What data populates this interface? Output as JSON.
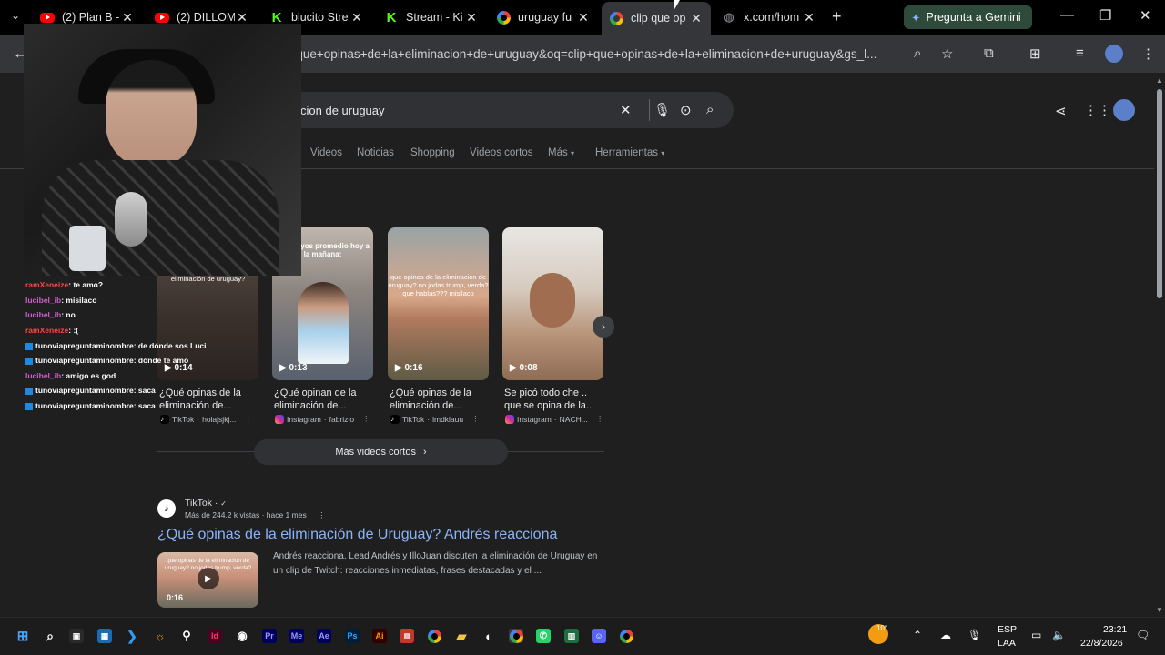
{
  "tabs": [
    {
      "title": "(2) Plan B -",
      "favicon": "youtube-icon"
    },
    {
      "title": "(2) DILLOM",
      "favicon": "youtube-icon"
    },
    {
      "title": "blucito Stre",
      "favicon": "kick-icon"
    },
    {
      "title": "Stream - Ki",
      "favicon": "kick-icon"
    },
    {
      "title": "uruguay fu",
      "favicon": "google-icon"
    },
    {
      "title": "clip que op",
      "favicon": "google-icon",
      "active": true
    },
    {
      "title": "x.com/hom",
      "favicon": "globe-icon"
    }
  ],
  "gemini_label": "Pregunta a Gemini",
  "omnibox_url": "p+que+opinas+de+la+eliminacion+de+uruguay&oq=clip+que+opinas+de+la+eliminacion+de+uruguay&gs_l...",
  "search_query": "cion de uruguay",
  "filters": [
    "Videos",
    "Noticias",
    "Shopping",
    "Videos cortos",
    "Más",
    "Herramientas"
  ],
  "short_videos": [
    {
      "duration": "0:14",
      "title_line1": "¿Qué opinas de la",
      "title_line2": "eliminación de...",
      "source": "TikTok",
      "author": "holajsjkj...",
      "overlay": "eliminación de uruguay?"
    },
    {
      "duration": "0:13",
      "title_line1": "¿Qué opinan de la",
      "title_line2": "eliminación de...",
      "source": "Instagram",
      "author": "fabrizio",
      "overlay": "uruguayos promedio hoy a la mañana:"
    },
    {
      "duration": "0:16",
      "title_line1": "¿Qué opinas de la",
      "title_line2": "eliminación de...",
      "source": "TikTok",
      "author": "lmdklauu",
      "overlay": "que opinas de la eliminacion de uruguay? no jodas trump, verda? que hablas??? misilaco"
    },
    {
      "duration": "0:08",
      "title_line1": "Se picó todo che ..",
      "title_line2": "que se opina de la...",
      "source": "Instagram",
      "author": "NACH...",
      "overlay": ""
    }
  ],
  "more_videos_label": "Más videos cortos",
  "result": {
    "source": "TikTok ·",
    "meta": "Más de 244.2 k vistas · hace 1 mes",
    "title": "¿Qué opinas de la eliminación de Uruguay? Andrés reacciona",
    "snippet": "Andrés reacciona. Lead Andrés y IlloJuan discuten la eliminación de Uruguay en un clip de Twitch: reacciones inmediatas, frases destacadas y el ...",
    "thumb_duration": "0:16",
    "thumb_overlay": "que opinas de la eliminacion de uruguay? no jodas trump, verda?"
  },
  "chat": [
    {
      "user": "ramXeneize",
      "msg": ": te amo?",
      "color": "red"
    },
    {
      "user": "lucibel_ib",
      "msg": ": misilaco",
      "color": "purple"
    },
    {
      "user": "lucibel_ib",
      "msg": ": no",
      "color": "purple"
    },
    {
      "user": "ramXeneize",
      "msg": ": :(",
      "color": "red"
    },
    {
      "user": "tunoviapreguntaminombre",
      "msg": ": de dónde sos Luci",
      "color": "white"
    },
    {
      "user": "tunoviapreguntaminombre",
      "msg": ": dónde te amo",
      "color": "white"
    },
    {
      "user": "lucibel_ib",
      "msg": ": amigo es god",
      "color": "purple"
    },
    {
      "user": "tunoviapreguntaminombre",
      "msg": ": saca",
      "color": "white"
    },
    {
      "user": "tunoviapreguntaminombre",
      "msg": ": saca",
      "color": "white"
    }
  ],
  "taskbar": {
    "weather": "10°",
    "lang1": "ESP",
    "lang2": "LAA",
    "time": "23:21",
    "date": "22/8/2026"
  }
}
